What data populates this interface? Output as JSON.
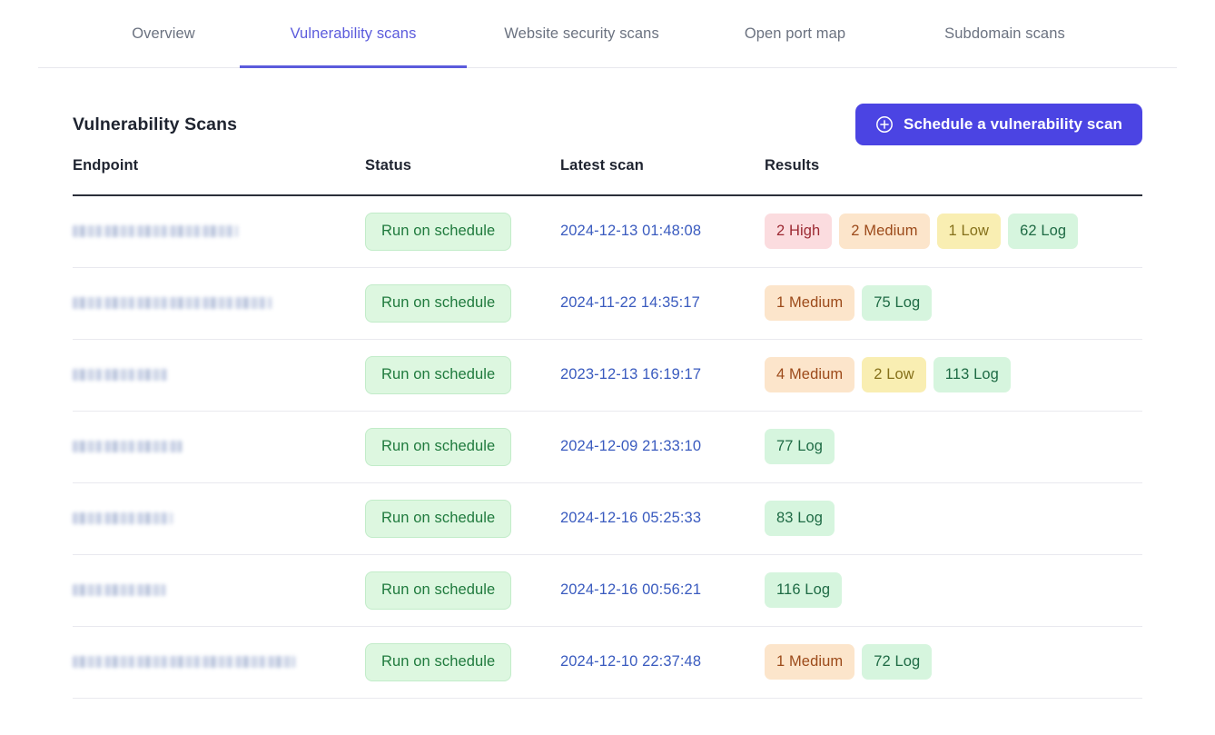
{
  "tabs": [
    {
      "label": "Overview",
      "active": false
    },
    {
      "label": "Vulnerability scans",
      "active": true
    },
    {
      "label": "Website security scans",
      "active": false
    },
    {
      "label": "Open port map",
      "active": false
    },
    {
      "label": "Subdomain scans",
      "active": false
    }
  ],
  "header": {
    "title": "Vulnerability Scans",
    "schedule_button": "Schedule a vulnerability scan",
    "schedule_icon": "plus-circle-icon"
  },
  "colors": {
    "accent": "#5b5bdc",
    "button": "#4b44e3",
    "link": "#3a5bbf",
    "high_bg": "#fbdcdf",
    "high_text": "#9d2a33",
    "medium_bg": "#fce5cb",
    "medium_text": "#9c4a1a",
    "low_bg": "#f9eeb2",
    "low_text": "#85701a",
    "log_bg": "#d6f5de",
    "log_text": "#1f6b45",
    "status_bg": "#ddf7e0",
    "status_text": "#1f7a3d"
  },
  "table": {
    "columns": [
      "Endpoint",
      "Status",
      "Latest scan",
      "Results"
    ],
    "rows": [
      {
        "endpoint": "",
        "endpoint_redacted": true,
        "endpoint_width": 182,
        "status": "Run on schedule",
        "latest_scan": "2024-12-13 01:48:08",
        "results": [
          {
            "label": "2 High",
            "level": "high"
          },
          {
            "label": "2 Medium",
            "level": "medium"
          },
          {
            "label": "1 Low",
            "level": "low"
          },
          {
            "label": "62 Log",
            "level": "log"
          }
        ]
      },
      {
        "endpoint": "",
        "endpoint_redacted": true,
        "endpoint_width": 219,
        "status": "Run on schedule",
        "latest_scan": "2024-11-22 14:35:17",
        "results": [
          {
            "label": "1 Medium",
            "level": "medium"
          },
          {
            "label": "75 Log",
            "level": "log"
          }
        ]
      },
      {
        "endpoint": "",
        "endpoint_redacted": true,
        "endpoint_width": 104,
        "status": "Run on schedule",
        "latest_scan": "2023-12-13 16:19:17",
        "results": [
          {
            "label": "4 Medium",
            "level": "medium"
          },
          {
            "label": "2 Low",
            "level": "low"
          },
          {
            "label": "113 Log",
            "level": "log"
          }
        ]
      },
      {
        "endpoint": "",
        "endpoint_redacted": true,
        "endpoint_width": 120,
        "status": "Run on schedule",
        "latest_scan": "2024-12-09 21:33:10",
        "results": [
          {
            "label": "77 Log",
            "level": "log"
          }
        ]
      },
      {
        "endpoint": "",
        "endpoint_redacted": true,
        "endpoint_width": 110,
        "status": "Run on schedule",
        "latest_scan": "2024-12-16 05:25:33",
        "results": [
          {
            "label": "83 Log",
            "level": "log"
          }
        ]
      },
      {
        "endpoint": "",
        "endpoint_redacted": true,
        "endpoint_width": 102,
        "status": "Run on schedule",
        "latest_scan": "2024-12-16 00:56:21",
        "results": [
          {
            "label": "116 Log",
            "level": "log"
          }
        ]
      },
      {
        "endpoint": "",
        "endpoint_redacted": true,
        "endpoint_width": 245,
        "status": "Run on schedule",
        "latest_scan": "2024-12-10 22:37:48",
        "results": [
          {
            "label": "1 Medium",
            "level": "medium"
          },
          {
            "label": "72 Log",
            "level": "log"
          }
        ]
      }
    ]
  }
}
